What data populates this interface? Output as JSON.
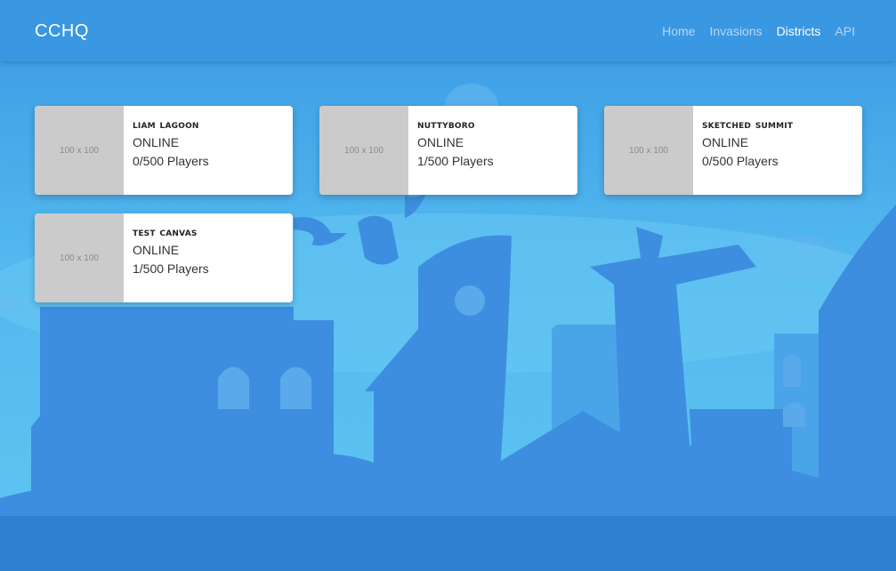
{
  "nav": {
    "brand": "CCHQ",
    "links": [
      {
        "label": "Home",
        "active": false
      },
      {
        "label": "Invasions",
        "active": false
      },
      {
        "label": "Districts",
        "active": true
      },
      {
        "label": "API",
        "active": false
      }
    ]
  },
  "districts": [
    {
      "thumb": "100 x 100",
      "name": "Liam Lagoon",
      "status": "ONLINE",
      "players": "0/500 Players"
    },
    {
      "thumb": "100 x 100",
      "name": "Nuttyboro",
      "status": "ONLINE",
      "players": "1/500 Players"
    },
    {
      "thumb": "100 x 100",
      "name": "Sketched Summit",
      "status": "ONLINE",
      "players": "0/500 Players"
    },
    {
      "thumb": "100 x 100",
      "name": "Test Canvas",
      "status": "ONLINE",
      "players": "1/500 Players"
    }
  ],
  "colors": {
    "navbar": "#3a97e2",
    "sky": "#52b6ee",
    "buildings": "#3d8ee0",
    "ground": "#2f80d3"
  }
}
